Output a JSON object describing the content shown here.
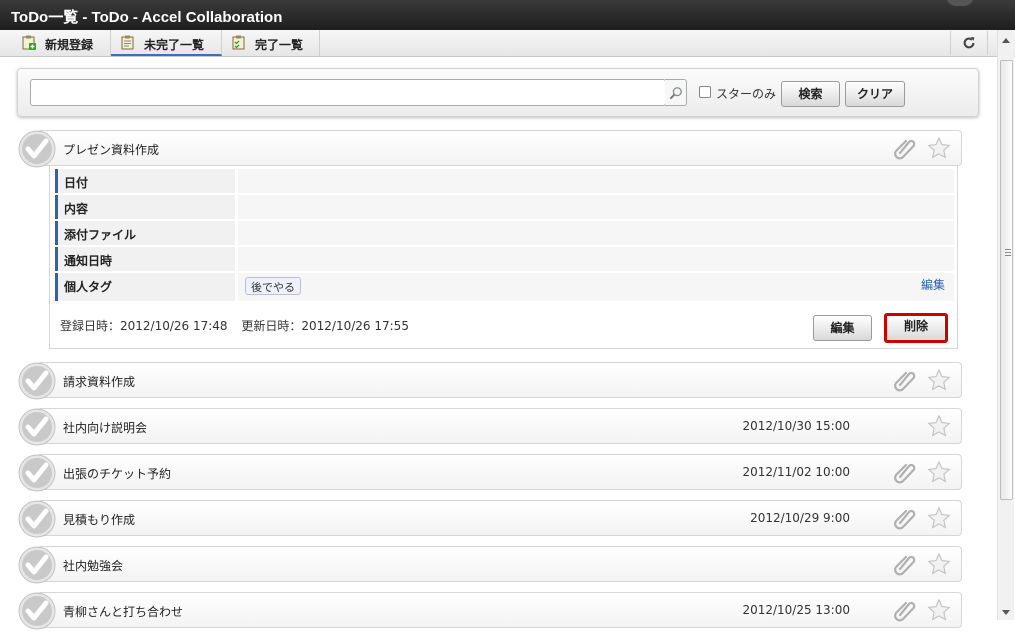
{
  "window": {
    "title": "ToDo一覧 - ToDo - Accel Collaboration"
  },
  "tabs": [
    {
      "label": "新規登録",
      "icon": "clipboard-add-icon"
    },
    {
      "label": "未完了一覧",
      "icon": "clipboard-icon",
      "active": true
    },
    {
      "label": "完了一覧",
      "icon": "clipboard-check-icon"
    }
  ],
  "search": {
    "value": "",
    "star_only_label": "スターのみ",
    "search_button": "検索",
    "clear_button": "クリア"
  },
  "todos": [
    {
      "title": "プレゼン資料作成",
      "date": "",
      "has_attachment": true,
      "expanded": true
    },
    {
      "title": "請求資料作成",
      "date": "",
      "has_attachment": true
    },
    {
      "title": "社内向け説明会",
      "date": "2012/10/30 15:00",
      "has_attachment": false
    },
    {
      "title": "出張のチケット予約",
      "date": "2012/11/02 10:00",
      "has_attachment": true
    },
    {
      "title": "見積もり作成",
      "date": "2012/10/29 9:00",
      "has_attachment": true
    },
    {
      "title": "社内勉強会",
      "date": "",
      "has_attachment": true
    },
    {
      "title": "青柳さんと打ち合わせ",
      "date": "2012/10/25 13:00",
      "has_attachment": true
    }
  ],
  "detail": {
    "labels": {
      "date": "日付",
      "content": "内容",
      "attachment": "添付ファイル",
      "notify": "通知日時",
      "tags": "個人タグ"
    },
    "tag": "後でやる",
    "tag_edit_link": "編集",
    "registered": "登録日時：2012/10/26 17:48",
    "updated": "更新日時：2012/10/26 17:55",
    "edit_button": "編集",
    "delete_button": "削除"
  },
  "colors": {
    "accent": "#3b6fb8",
    "highlight": "#cc0000",
    "check": "#6aaa3a"
  }
}
